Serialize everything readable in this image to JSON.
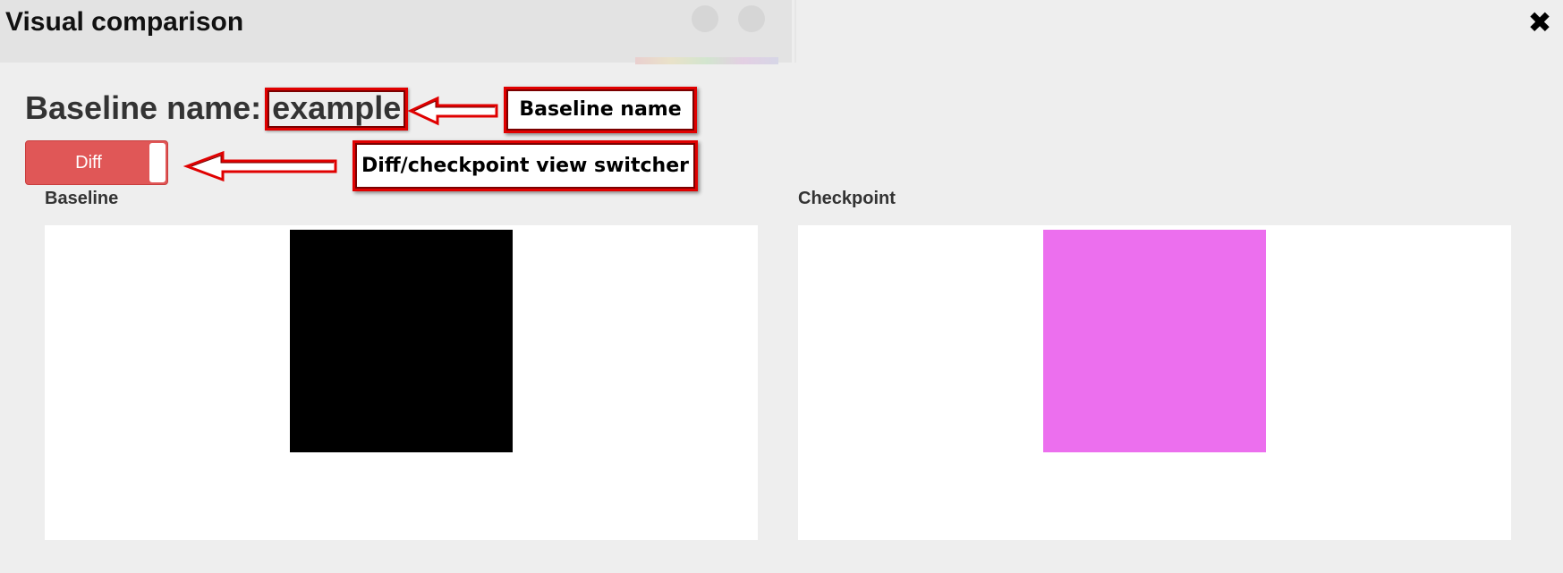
{
  "dialog": {
    "title": "Visual comparison",
    "close_label": "✖"
  },
  "baseline": {
    "label": "Baseline name:",
    "value": "example"
  },
  "switcher": {
    "label": "Diff",
    "color": "#e05757"
  },
  "annotations": {
    "baseline_name": "Baseline name",
    "view_switcher": "Diff/checkpoint view switcher",
    "border_color": "#e00000"
  },
  "panels": {
    "baseline": {
      "label": "Baseline",
      "square_color": "#000000"
    },
    "checkpoint": {
      "label": "Checkpoint",
      "square_color": "#ec6fee"
    }
  }
}
